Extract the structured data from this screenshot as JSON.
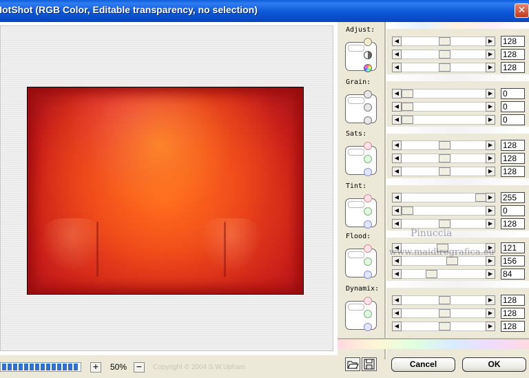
{
  "window": {
    "title": "HotShot (RGB Color, Editable transparency, no selection)",
    "close_glyph": "✕"
  },
  "footer": {
    "zoom_in_glyph": "+",
    "zoom_out_glyph": "−",
    "zoom": "50%",
    "copyright": "Copyright © 2004 S.W.Upham",
    "progress": 1.0
  },
  "sections": [
    {
      "label": "Adjust:",
      "dial_icons": [
        "sun-icon",
        "contrast-icon",
        "color-wheel-icon"
      ],
      "values": [
        "128",
        "128",
        "128"
      ]
    },
    {
      "label": "Grain:",
      "dial_icons": [
        "grain-coarse-icon",
        "grain-medium-icon",
        "grain-fine-icon"
      ],
      "values": [
        "0",
        "0",
        "0"
      ]
    },
    {
      "label": "Sats:",
      "dial_icons": [
        "red-dial-icon",
        "green-dial-icon",
        "blue-dial-icon"
      ],
      "values": [
        "128",
        "128",
        "128"
      ]
    },
    {
      "label": "Tint:",
      "dial_icons": [
        "red-dial-icon",
        "green-dial-icon",
        "blue-dial-icon"
      ],
      "values": [
        "255",
        "0",
        "128"
      ]
    },
    {
      "label": "Flood:",
      "dial_icons": [
        "red-dial-icon",
        "green-dial-icon",
        "blue-dial-icon"
      ],
      "values": [
        "121",
        "156",
        "84"
      ]
    },
    {
      "label": "Dynamix:",
      "dial_icons": [
        "red-dial-icon",
        "green-dial-icon",
        "blue-dial-icon"
      ],
      "values": [
        "128",
        "128",
        "128"
      ]
    }
  ],
  "watermark": {
    "line1": "Pinuccia",
    "line2": "www.maidiregrafica.eu"
  },
  "buttons": {
    "cancel": "Cancel",
    "ok": "OK",
    "open_icon": "folder-open-icon",
    "save_icon": "save-disk-icon"
  },
  "colors": {
    "titlebar": "#0b58d8",
    "progress": "#2f6fd6",
    "panel": "#ece9d8"
  }
}
